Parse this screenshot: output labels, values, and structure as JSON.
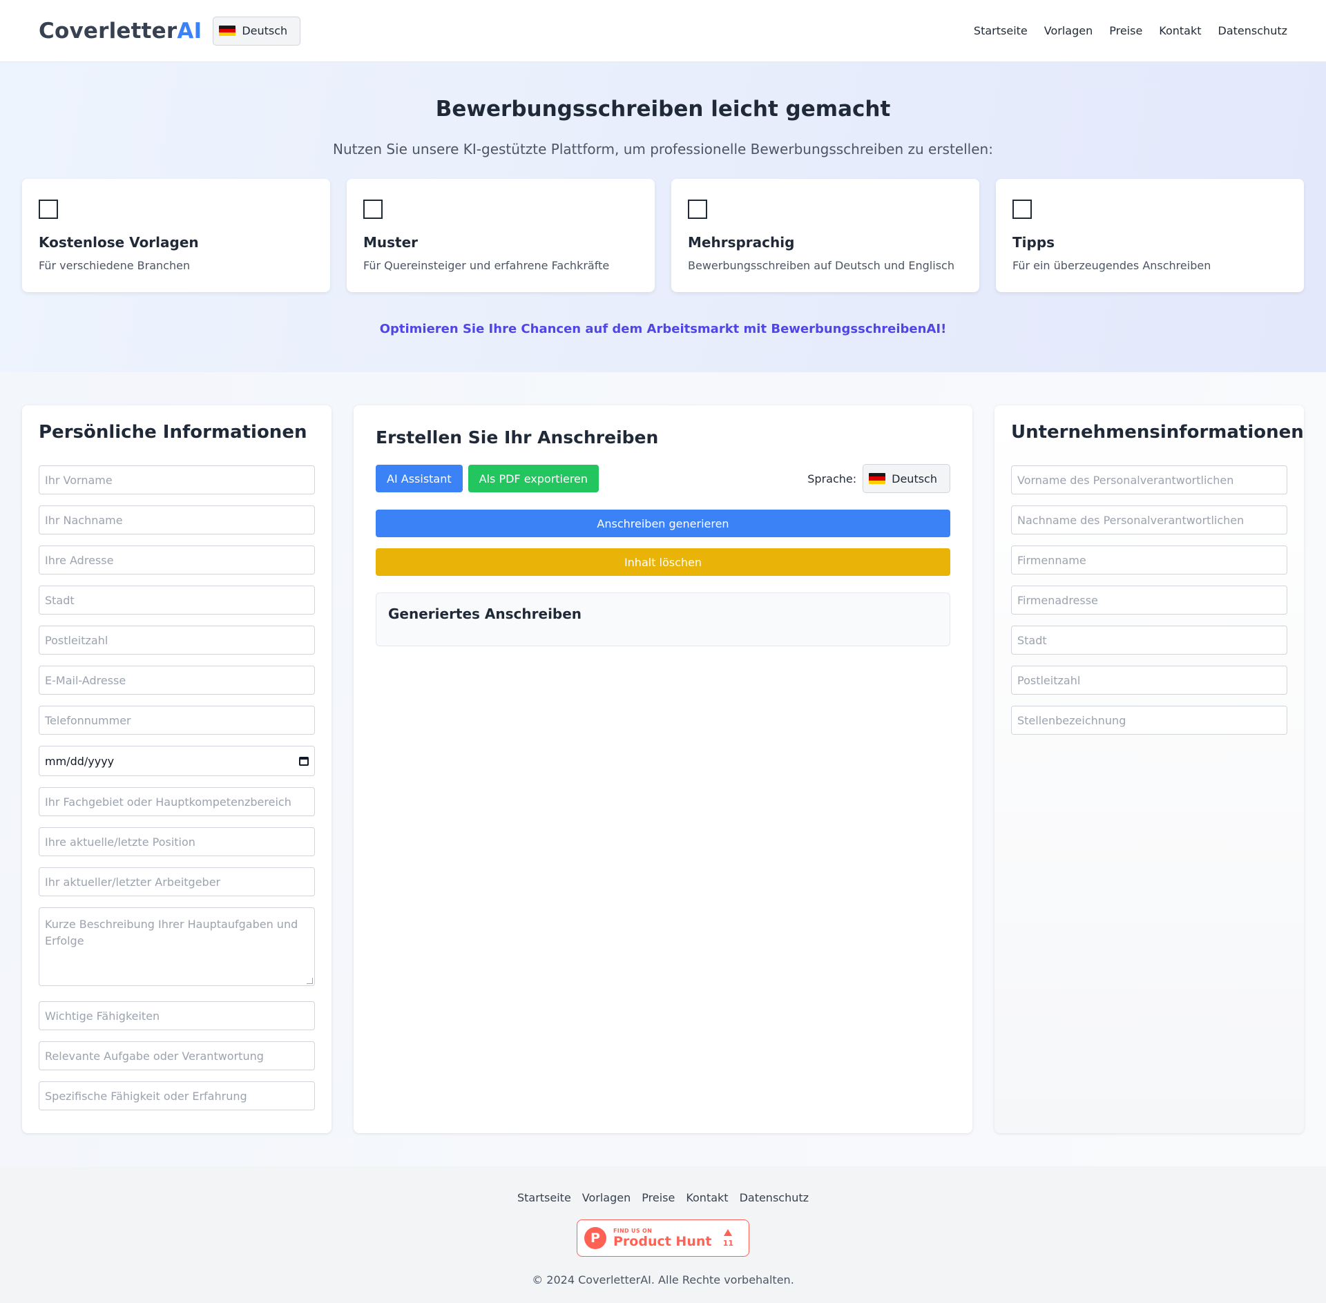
{
  "header": {
    "logo_main": "Coverletter",
    "logo_accent": "AI",
    "language": "Deutsch",
    "nav": [
      "Startseite",
      "Vorlagen",
      "Preise",
      "Kontakt",
      "Datenschutz"
    ]
  },
  "hero": {
    "title": "Bewerbungsschreiben leicht gemacht",
    "subtitle": "Nutzen Sie unsere KI-gestützte Plattform, um professionelle Bewerbungsschreiben zu erstellen:",
    "features": [
      {
        "title": "Kostenlose Vorlagen",
        "text": "Für verschiedene Branchen"
      },
      {
        "title": "Muster",
        "text": "Für Quereinsteiger und erfahrene Fachkräfte"
      },
      {
        "title": "Mehrsprachig",
        "text": "Bewerbungsschreiben auf Deutsch und Englisch"
      },
      {
        "title": "Tipps",
        "text": "Für ein überzeugendes Anschreiben"
      }
    ],
    "tagline": "Optimieren Sie Ihre Chancen auf dem Arbeitsmarkt mit BewerbungsschreibenAI!"
  },
  "personal": {
    "title": "Persönliche Informationen",
    "fields": [
      "Ihr Vorname",
      "Ihr Nachname",
      "Ihre Adresse",
      "Stadt",
      "Postleitzahl",
      "E-Mail-Adresse",
      "Telefonnummer"
    ],
    "date_placeholder": "mm/dd/yyyy",
    "fields2": [
      "Ihr Fachgebiet oder Hauptkompetenzbereich",
      "Ihre aktuelle/letzte Position",
      "Ihr aktueller/letzter Arbeitgeber"
    ],
    "textarea": "Kurze Beschreibung Ihrer Hauptaufgaben und Erfolge",
    "fields3": [
      "Wichtige Fähigkeiten",
      "Relevante Aufgabe oder Verantwortung",
      "Spezifische Fähigkeit oder Erfahrung"
    ]
  },
  "center": {
    "title": "Erstellen Sie Ihr Anschreiben",
    "ai_button": "AI Assistant",
    "pdf_button": "Als PDF exportieren",
    "language_label": "Sprache:",
    "language": "Deutsch",
    "generate_button": "Anschreiben generieren",
    "clear_button": "Inhalt löschen",
    "result_title": "Generiertes Anschreiben"
  },
  "company": {
    "title": "Unternehmensinformationen",
    "fields": [
      "Vorname des Personalverantwortlichen",
      "Nachname des Personalverantwortlichen",
      "Firmenname",
      "Firmenadresse",
      "Stadt",
      "Postleitzahl",
      "Stellenbezeichnung"
    ]
  },
  "footer": {
    "nav": [
      "Startseite",
      "Vorlagen",
      "Preise",
      "Kontakt",
      "Datenschutz"
    ],
    "ph_small": "FIND US ON",
    "ph_big": "Product Hunt",
    "ph_count": "11",
    "copyright": "© 2024 CoverletterAI. Alle Rechte vorbehalten."
  },
  "colors": {
    "accent_blue": "#3b82f6",
    "green": "#22c55e",
    "yellow": "#eab308",
    "indigo": "#4f46e5",
    "product_hunt": "#ff6154"
  }
}
